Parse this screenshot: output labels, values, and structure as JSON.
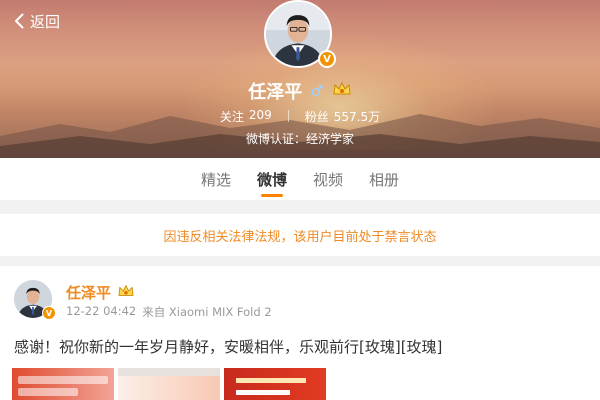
{
  "nav": {
    "back_label": "返回"
  },
  "profile": {
    "name": "任泽平",
    "gender_symbol": "♂",
    "verified_badge": "V",
    "following_label": "关注",
    "following_count": "209",
    "followers_label": "粉丝",
    "followers_count": "557.5万",
    "verification": "微博认证：经济学家"
  },
  "tabs": [
    {
      "label": "精选",
      "active": false
    },
    {
      "label": "微博",
      "active": true
    },
    {
      "label": "视频",
      "active": false
    },
    {
      "label": "相册",
      "active": false
    }
  ],
  "notice": {
    "text": "因违反相关法律法规，该用户目前处于禁言状态"
  },
  "post": {
    "author": "任泽平",
    "timestamp": "12-22 04:42",
    "source": "来自 Xiaomi MIX Fold 2",
    "text": "感谢！祝你新的一年岁月静好，安暖相伴，乐观前行[玫瑰][玫瑰]"
  },
  "colors": {
    "accent": "#ff8200",
    "notice_text": "#f08a24",
    "verified_badge": "#f29400"
  },
  "icons": [
    "back-chevron-icon",
    "verified-v-icon",
    "male-icon",
    "member-crown-icon"
  ]
}
